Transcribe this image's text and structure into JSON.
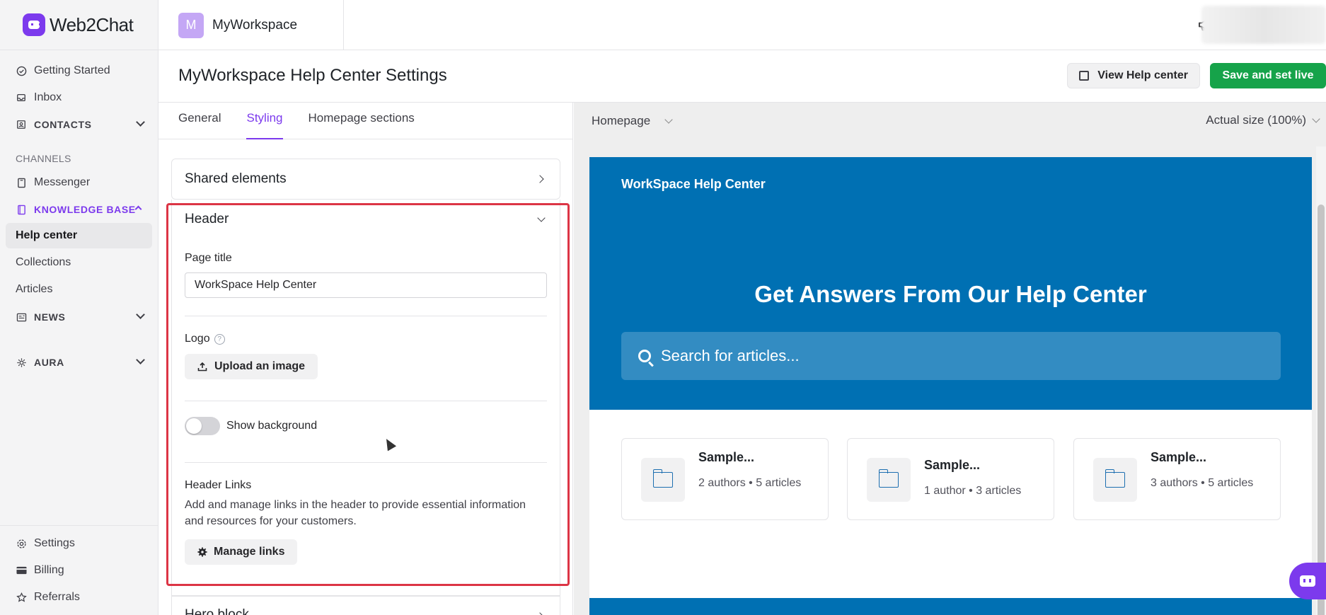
{
  "app": {
    "name": "Web2Chat"
  },
  "workspace": {
    "initial": "M",
    "name": "MyWorkspace"
  },
  "sidebar": {
    "top_items": [
      {
        "label": "Getting Started",
        "icon": "check-circle-icon"
      },
      {
        "label": "Inbox",
        "icon": "inbox-icon"
      }
    ],
    "contacts": {
      "label": "CONTACTS",
      "icon": "contacts-icon"
    },
    "channels_label": "CHANNELS",
    "messenger": {
      "label": "Messenger",
      "icon": "messenger-icon"
    },
    "knowledge_base": {
      "label": "KNOWLEDGE BASE",
      "icon": "book-icon"
    },
    "kb_items": [
      "Help center",
      "Collections",
      "Articles"
    ],
    "news": {
      "label": "NEWS",
      "icon": "news-icon"
    },
    "aura": {
      "label": "AURA",
      "icon": "aura-icon"
    },
    "bottom_items": [
      {
        "label": "Settings",
        "icon": "gear-icon"
      },
      {
        "label": "Billing",
        "icon": "card-icon"
      },
      {
        "label": "Referrals",
        "icon": "star-icon"
      }
    ]
  },
  "header": {
    "title": "MyWorkspace Help Center Settings",
    "view_button": "View Help center",
    "save_button": "Save and set live"
  },
  "tabs": [
    "General",
    "Styling",
    "Homepage sections"
  ],
  "active_tab": "Styling",
  "sections": {
    "shared": "Shared elements",
    "header": "Header",
    "hero": "Hero block"
  },
  "header_form": {
    "page_title_label": "Page title",
    "page_title_value": "WorkSpace Help Center",
    "logo_label": "Logo",
    "upload_button": "Upload an image",
    "show_background_label": "Show background",
    "show_background_on": false,
    "links_label": "Header Links",
    "links_description": "Add and manage links in the header to provide essential information and resources for your customers.",
    "manage_links_button": "Manage links"
  },
  "preview": {
    "page_select": "Homepage",
    "size_select": "Actual size (100%)",
    "brand": "WorkSpace Help Center",
    "hero_title": "Get Answers From Our Help Center",
    "search_placeholder": "Search for articles...",
    "collections": [
      {
        "title": "Sample...",
        "meta": "2 authors • 5 articles"
      },
      {
        "title": "Sample...",
        "meta": "1 author • 3 articles"
      },
      {
        "title": "Sample...",
        "meta": "3 authors • 5 articles"
      }
    ]
  },
  "colors": {
    "accent": "#7c3aed",
    "save": "#16a34a",
    "hero_blue": "#0070b3",
    "highlight": "#dc3545"
  }
}
